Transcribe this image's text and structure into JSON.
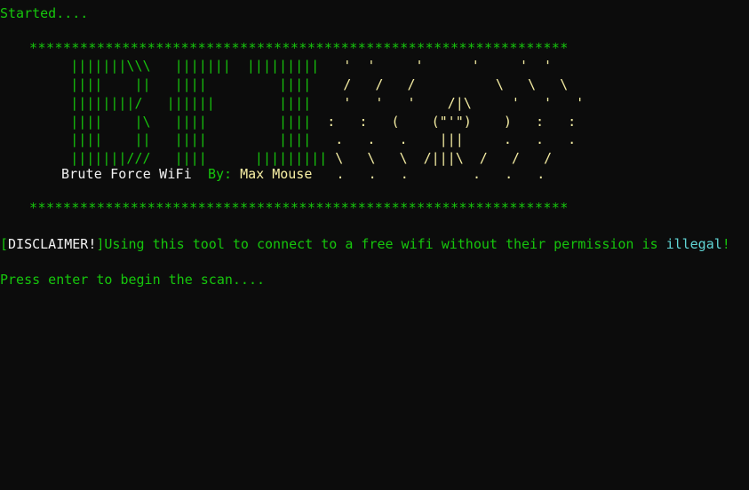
{
  "terminal": {
    "started_text": "Started....",
    "stars_top": "****************************************************************",
    "stars_bottom": "****************************************************************",
    "banner_lines": [
      {
        "left": "       |||||||\\\\\\   |||||||  |||||||||",
        "right": "   '  '     '      '     '  '"
      },
      {
        "left": "       ||||    ||   ||||         ||||",
        "right": "    /   /   /          \\   \\   \\"
      },
      {
        "left": "       ||||||||/   ||||||        ||||",
        "right": "    '   '   '    /|\\     '   '   '"
      },
      {
        "left": "       ||||    |\\   ||||         ||||",
        "right": "  :   :   (    (\"'\")    )   :   :"
      },
      {
        "left": "       ||||    ||   ||||         ||||",
        "right": "   .   .   .    |||     .   .   ."
      },
      {
        "left": "       |||||||///   ||||      |||||||||",
        "right": " \\   \\   \\  /|||\\  /   /   /"
      }
    ],
    "credit": {
      "title": "Brute Force WiFi",
      "by_label": "By:",
      "author": "Max Mouse",
      "dots": "   .   .   .        .   .   ."
    },
    "disclaimer": {
      "open_bracket": "[",
      "tag": "DISCLAIMER!",
      "close_bracket": "]",
      "message": "Using this tool to connect to a free wifi without their permission is ",
      "highlight": "illegal",
      "end": "!"
    },
    "prompt": "Press enter to begin the scan....",
    "colors": {
      "background": "#0c0c0c",
      "green": "#16c60c",
      "yellow": "#f9f1a5",
      "white": "#f2f2f2",
      "cyan": "#61d6d6"
    }
  }
}
